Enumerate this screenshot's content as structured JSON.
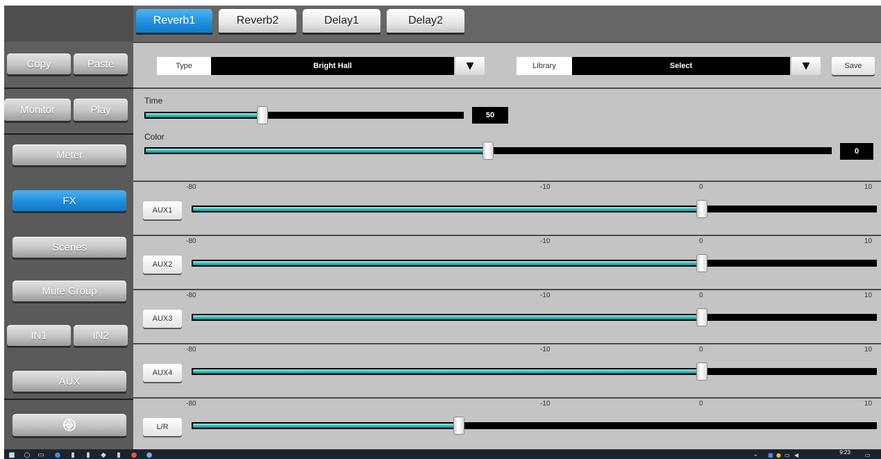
{
  "tabs": [
    {
      "label": "Reverb1",
      "active": true
    },
    {
      "label": "Reverb2",
      "active": false
    },
    {
      "label": "Delay1",
      "active": false
    },
    {
      "label": "Delay2",
      "active": false
    }
  ],
  "sidebar": {
    "copy": "Copy",
    "paste": "Paste",
    "monitor": "Monitor",
    "play": "Play",
    "meter": "Meter",
    "fx": "FX",
    "scenes": "Scenes",
    "mute_group": "Mute Group",
    "in1": "IN1",
    "in2": "IN2",
    "aux": "AUX",
    "settings_icon": "crosshair-settings-icon"
  },
  "type_row": {
    "type_label": "Type",
    "type_value": "Bright Hall",
    "library_label": "Library",
    "library_value": "Select",
    "save_label": "Save"
  },
  "params": {
    "time": {
      "label": "Time",
      "value": "50",
      "level": 0.37
    },
    "color": {
      "label": "Color",
      "value": "0",
      "level": 0.5
    }
  },
  "scale_labels": [
    "-80",
    "-10",
    "0",
    "10"
  ],
  "sends": [
    {
      "label": "AUX1",
      "level": 0.745
    },
    {
      "label": "AUX2",
      "level": 0.745
    },
    {
      "label": "AUX3",
      "level": 0.745
    },
    {
      "label": "AUX4",
      "level": 0.745
    },
    {
      "label": "L/R",
      "level": 0.39
    }
  ],
  "taskbar": {
    "clock": "9:23"
  },
  "colors": {
    "accent_blue": "#1e8ede",
    "slider_fill": "#2db4b4",
    "panel_bg": "#c4c4c4"
  }
}
